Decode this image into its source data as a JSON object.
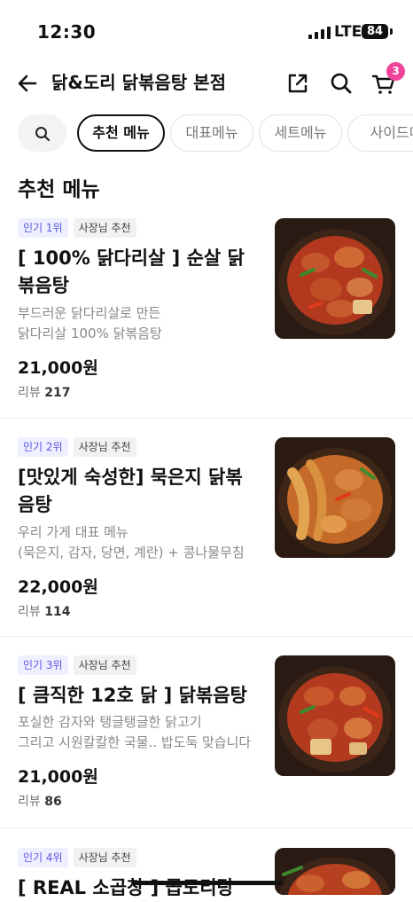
{
  "status": {
    "time": "12:30",
    "network": "LTE",
    "battery": "84"
  },
  "header": {
    "store_name": "닭&도리 닭볶음탕 본점",
    "cart_count": "3"
  },
  "tabs": [
    "추천 메뉴",
    "대표메뉴",
    "세트메뉴",
    "사이드메"
  ],
  "section_title": "추천 메뉴",
  "items": [
    {
      "rank": "인기 1위",
      "tag": "사장님 추천",
      "name": "[ 100% 닭다리살 ] 순살 닭볶음탕",
      "desc": "부드러운 닭다리살로 만든\n닭다리살 100% 닭볶음탕",
      "price": "21,000원",
      "review_label": "리뷰",
      "review_count": "217"
    },
    {
      "rank": "인기 2위",
      "tag": "사장님 추천",
      "name": "[맛있게 숙성한] 묵은지 닭볶음탕",
      "desc": "우리 가게 대표 메뉴\n(묵은지, 감자, 당면, 계란) + 콩나물무침",
      "price": "22,000원",
      "review_label": "리뷰",
      "review_count": "114"
    },
    {
      "rank": "인기 3위",
      "tag": "사장님 추천",
      "name": "[ 큼직한 12호 닭 ] 닭볶음탕",
      "desc": "포실한 감자와 탱글탱글한 닭고기\n그리고 시원칼칼한 국물.. 밥도둑 맞습니다",
      "price": "21,000원",
      "review_label": "리뷰",
      "review_count": "86"
    },
    {
      "rank": "인기 4위",
      "tag": "사장님 추천",
      "name": "[ REAL 소곱창 ] 곱도리탕"
    }
  ],
  "colors": {
    "accent_badge": "#f0449b",
    "rank_badge_text": "#5a55e0",
    "rank_badge_bg": "#eef0ff"
  }
}
